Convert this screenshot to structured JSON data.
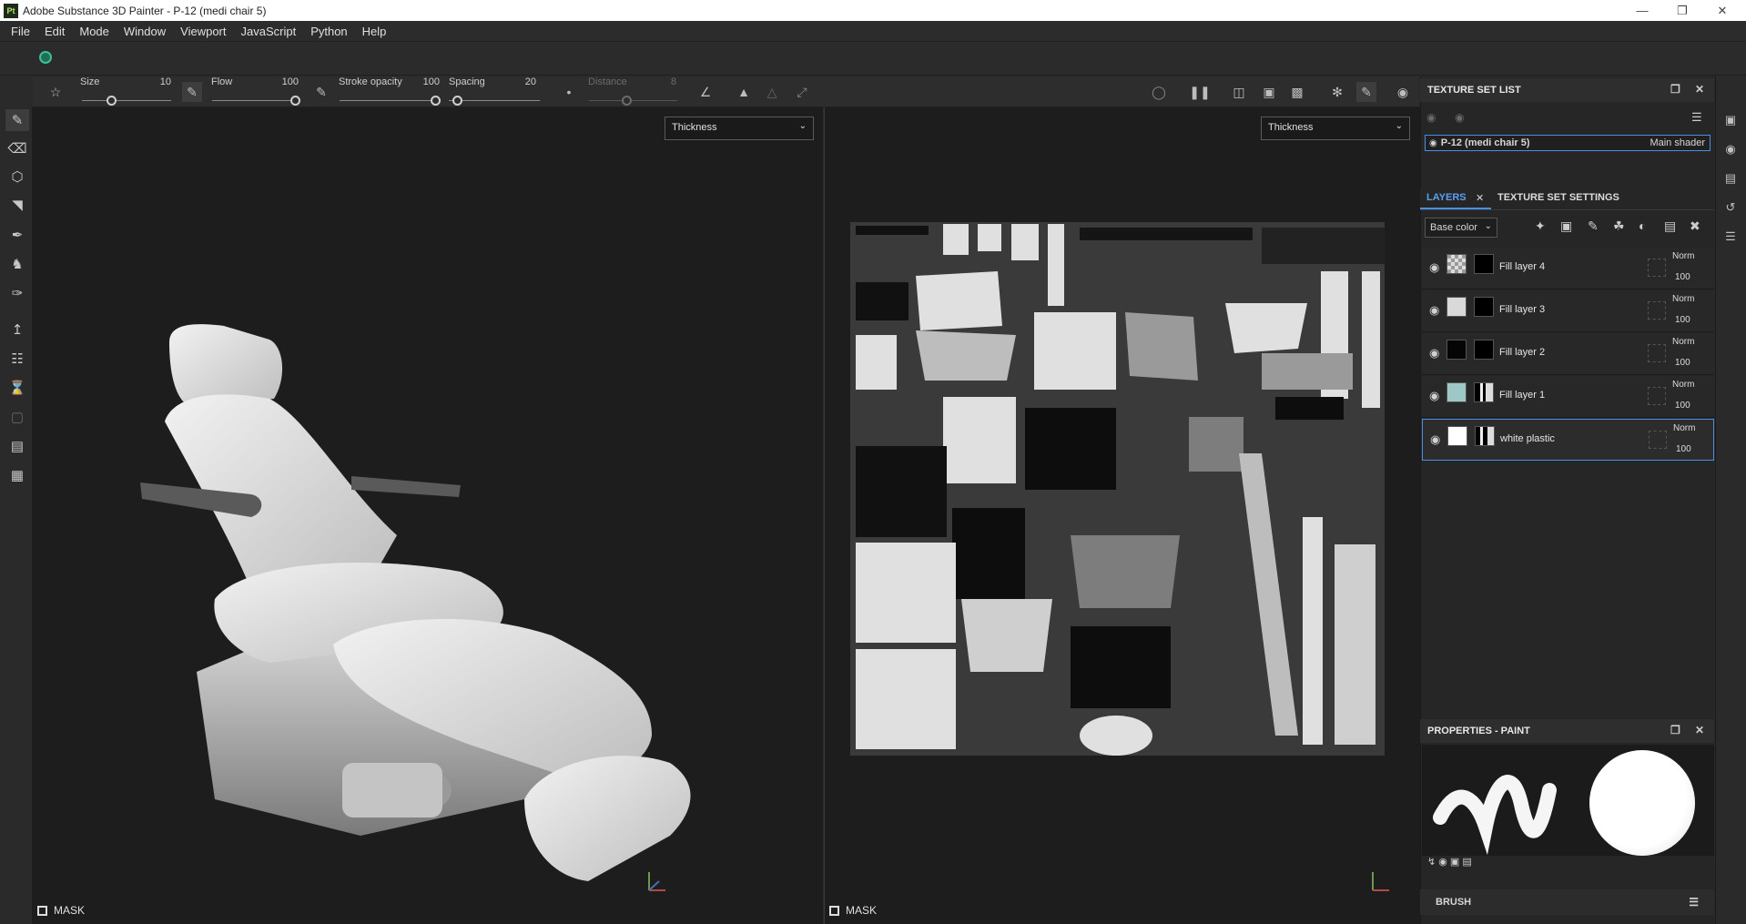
{
  "window": {
    "app_badge": "Pt",
    "title": "Adobe Substance 3D Painter - P-12 (medi chair 5)",
    "controls": [
      "minimize",
      "restore",
      "close"
    ]
  },
  "menu": [
    "File",
    "Edit",
    "Mode",
    "Window",
    "Viewport",
    "JavaScript",
    "Python",
    "Help"
  ],
  "brush_toolbar": {
    "size_label": "Size",
    "size_value": "10",
    "flow_label": "Flow",
    "flow_value": "100",
    "stroke_opacity_label": "Stroke opacity",
    "stroke_opacity_value": "100",
    "spacing_label": "Spacing",
    "spacing_value": "20",
    "distance_label": "Distance",
    "distance_value": "8"
  },
  "viewport_3d": {
    "channel": "Thickness",
    "mask_label": "MASK",
    "model": "medical chair"
  },
  "viewport_2d": {
    "channel": "Thickness",
    "mask_label": "MASK"
  },
  "texture_set_list": {
    "title": "TEXTURE SET LIST",
    "item_name": "P-12 (medi chair 5)",
    "item_shader": "Main shader"
  },
  "layers_panel": {
    "tab_layers": "LAYERS",
    "tab_settings": "TEXTURE SET SETTINGS",
    "channel": "Base color",
    "layers": [
      {
        "name": "Fill layer 4",
        "blend": "Norm",
        "opacity": "100",
        "color": "checker",
        "mask": "#000000"
      },
      {
        "name": "Fill layer 3",
        "blend": "Norm",
        "opacity": "100",
        "color": "#d9d9d9",
        "mask": "#000000"
      },
      {
        "name": "Fill layer 2",
        "blend": "Norm",
        "opacity": "100",
        "color": "#050505",
        "mask": "#000000"
      },
      {
        "name": "Fill layer 1",
        "blend": "Norm",
        "opacity": "100",
        "color": "#9ec8c6",
        "mask": "mixed"
      },
      {
        "name": "white plastic",
        "blend": "Norm",
        "opacity": "100",
        "color": "#ffffff",
        "mask": "mixed",
        "selected": true
      }
    ]
  },
  "properties": {
    "title": "PROPERTIES - PAINT",
    "brush_label": "BRUSH"
  },
  "colors": {
    "accent": "#4a90e2",
    "status": "#3cc098"
  }
}
